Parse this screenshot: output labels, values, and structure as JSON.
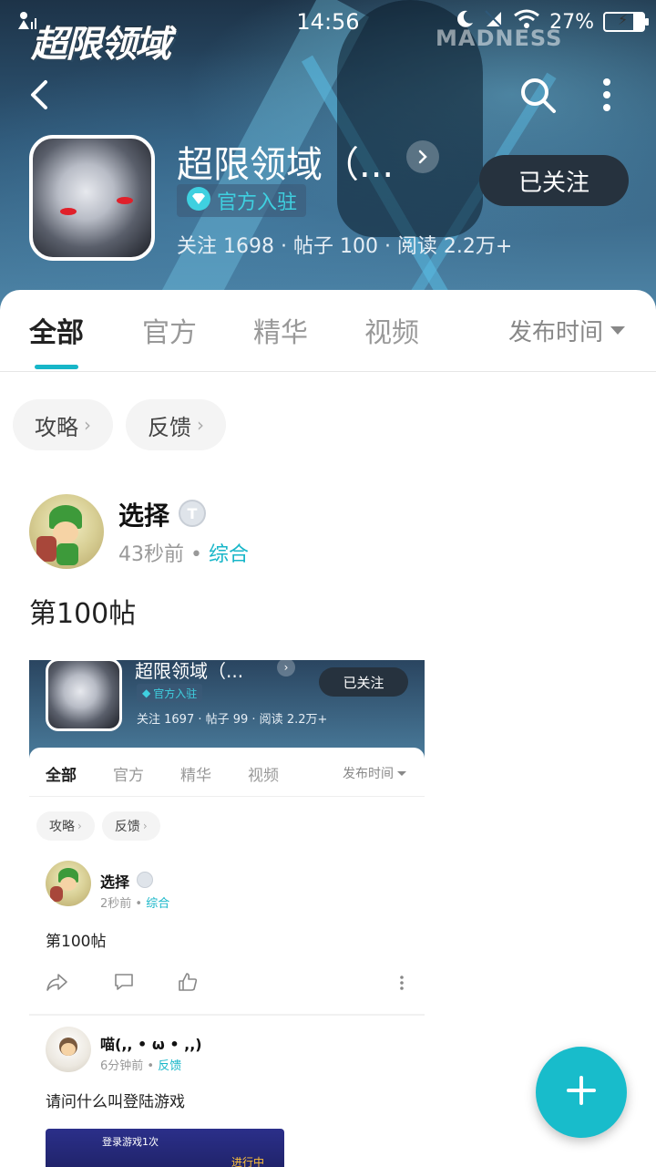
{
  "status_bar": {
    "time": "14:56",
    "battery": "27%",
    "battery_level": 0.27,
    "icons": [
      "person-signal-icon",
      "moon-icon",
      "mute-icon",
      "wifi-icon",
      "battery-icon"
    ]
  },
  "banner": {
    "wordmark": "超限领域",
    "madness": "MADNESS"
  },
  "nav": {
    "icons": [
      "back-icon",
      "search-icon",
      "more-icon"
    ]
  },
  "app": {
    "title": "超限领域（...",
    "badge": "官方入驻",
    "stats": "关注 1698 · 帖子 100 · 阅读 2.2万+",
    "follow_label": "已关注"
  },
  "tabs": {
    "items": [
      "全部",
      "官方",
      "精华",
      "视频"
    ],
    "active": "全部",
    "sort_label": "发布时间"
  },
  "chips": [
    "攻略",
    "反馈"
  ],
  "post": {
    "author": "选择",
    "level": "T",
    "time": "43秒前",
    "dot": "•",
    "category": "综合",
    "text": "第100帖",
    "embedded": {
      "title": "超限领域（...",
      "badge": "官方入驻",
      "stats": "关注 1697 · 帖子 99 · 阅读 2.2万+",
      "follow_label": "已关注",
      "tabs": [
        "全部",
        "官方",
        "精华",
        "视频"
      ],
      "sort_label": "发布时间",
      "chips": [
        "攻略",
        "反馈"
      ],
      "post1": {
        "author": "选择",
        "time": "2秒前",
        "category": "综合",
        "text": "第100帖"
      },
      "post2": {
        "author": "喵(,, • ω • ,,)",
        "time": "6分钟前",
        "category": "反馈",
        "text": "请问什么叫登陆游戏",
        "image_text": "登录游戏1次",
        "image_status": "进行中"
      }
    }
  },
  "fab_icon": "plus-icon",
  "colors": {
    "accent": "#18bccb",
    "follow_bg": "#26323e"
  }
}
